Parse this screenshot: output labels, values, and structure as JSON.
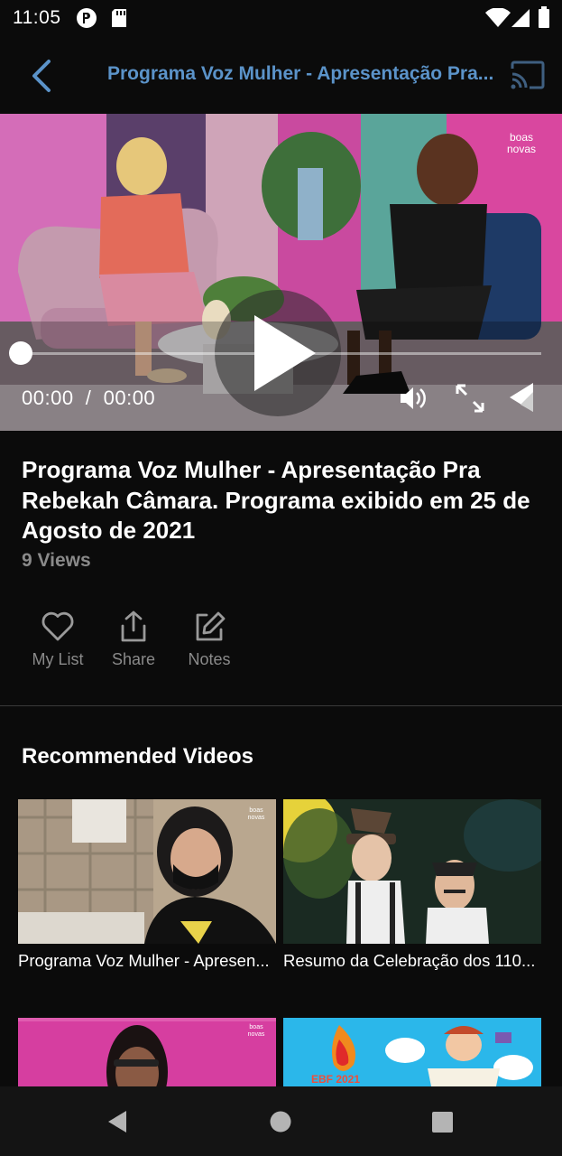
{
  "status_bar": {
    "time": "11:05",
    "icons": [
      "podcast-app-icon",
      "sd-card-icon",
      "wifi-icon",
      "cell-signal-icon",
      "battery-icon"
    ]
  },
  "app_bar": {
    "title": "Programa Voz Mulher - Apresentação Pra...",
    "accent_color": "#5b93c9"
  },
  "player": {
    "time_display": "00:00  /  00:00",
    "progress": 0,
    "watermark": "boas novas"
  },
  "video": {
    "title": "Programa Voz Mulher - Apresentação Pra Rebekah Câmara. Programa exibido em 25 de Agosto de 2021",
    "views": "9 Views"
  },
  "actions": [
    {
      "label": "My List",
      "icon": "heart-icon"
    },
    {
      "label": "Share",
      "icon": "share-icon"
    },
    {
      "label": "Notes",
      "icon": "edit-icon"
    }
  ],
  "recommended": {
    "heading": "Recommended Videos",
    "items": [
      {
        "title": "Programa Voz Mulher - Apresen..."
      },
      {
        "title": "Resumo da Celebração dos 110..."
      },
      {
        "title": ""
      },
      {
        "title": ""
      }
    ],
    "thumb_text": [
      "EBF 2021"
    ]
  },
  "nav_bar": {
    "icons": [
      "back-triangle-icon",
      "home-circle-icon",
      "recents-square-icon"
    ]
  }
}
